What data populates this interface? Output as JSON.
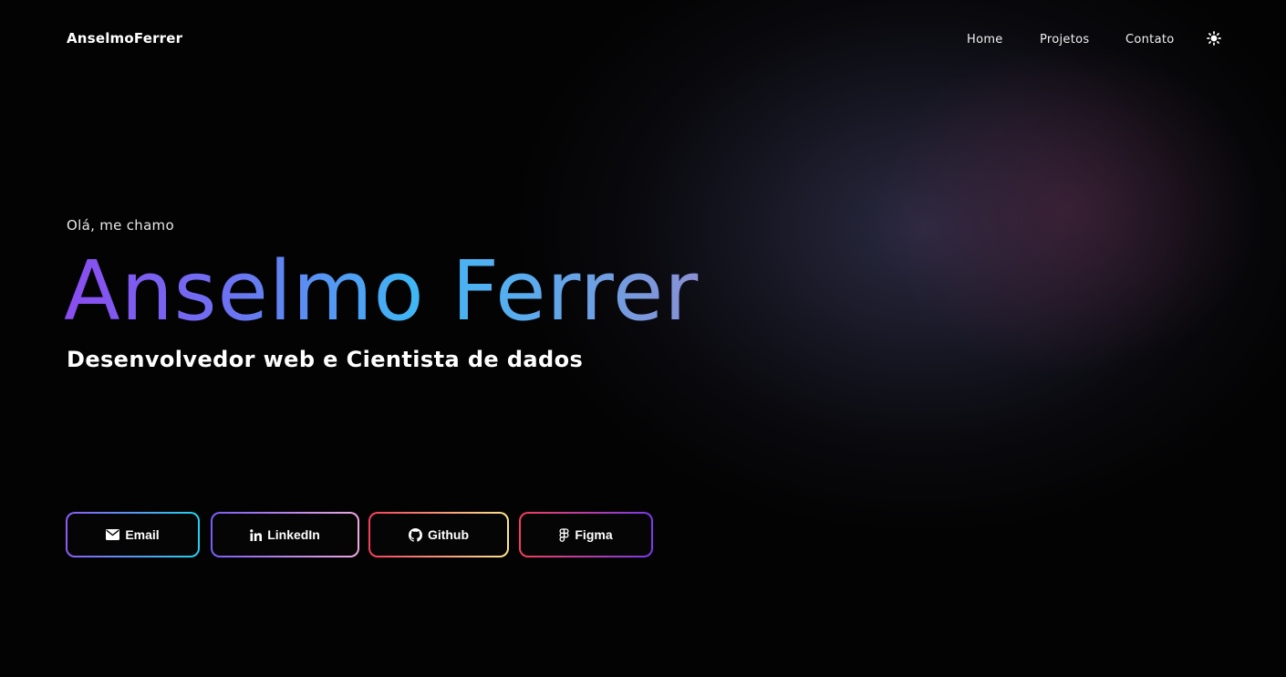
{
  "header": {
    "brand": "AnselmoFerrer",
    "nav": [
      {
        "label": "Home"
      },
      {
        "label": "Projetos"
      },
      {
        "label": "Contato"
      }
    ],
    "theme_toggle_icon": "sun-icon"
  },
  "hero": {
    "greeting": "Olá, me chamo",
    "name": "Anselmo Ferrer",
    "subtitle": "Desenvolvedor web e Cientista de dados"
  },
  "links": [
    {
      "label": "Email",
      "icon": "envelope-icon"
    },
    {
      "label": "LinkedIn",
      "icon": "linkedin-icon"
    },
    {
      "label": "Github",
      "icon": "github-icon"
    },
    {
      "label": "Figma",
      "icon": "figma-icon"
    }
  ],
  "colors": {
    "background": "#030303",
    "name_gradient": [
      "#8b4cf0",
      "#40b6f4",
      "#8a8fd4"
    ],
    "email_border": [
      "#8b5cf6",
      "#22d3ee"
    ],
    "linkedin_border": [
      "#7c5cf6",
      "#f0a8e0"
    ],
    "github_border": [
      "#f43f5e",
      "#fde68a"
    ],
    "figma_border": [
      "#f43f5e",
      "#7c3aed"
    ]
  }
}
